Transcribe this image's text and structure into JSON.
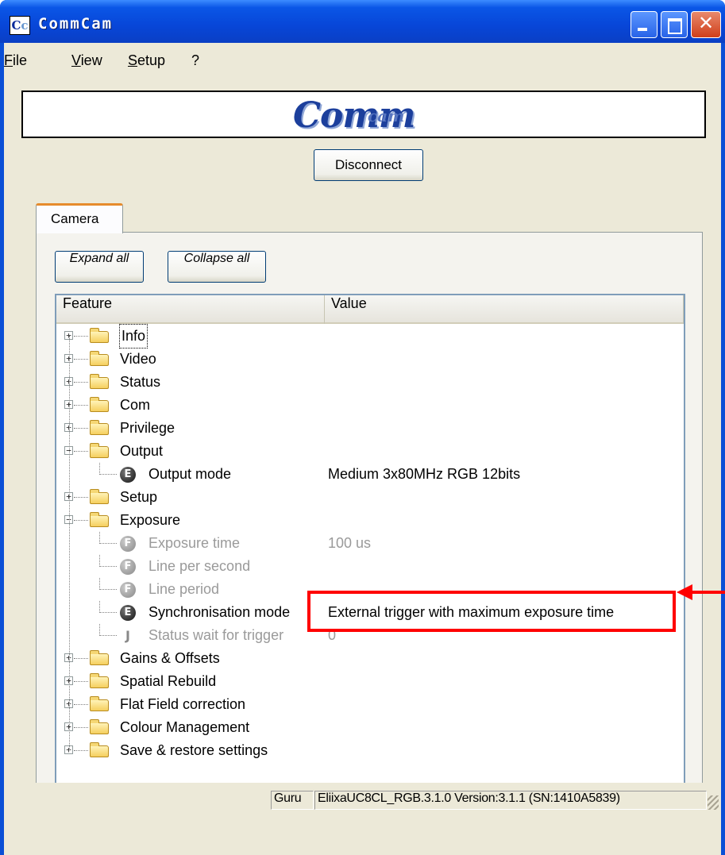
{
  "window": {
    "title": "CommCam",
    "icon": "app-icon",
    "controls": [
      "minimize",
      "maximize",
      "close"
    ]
  },
  "menu": [
    {
      "label": "File",
      "accel": "F"
    },
    {
      "label": "View",
      "accel": "V"
    },
    {
      "label": "Setup",
      "accel": "S"
    },
    {
      "label": "?",
      "accel": ""
    }
  ],
  "logo": {
    "text": "Comm",
    "sub": "cam"
  },
  "buttons": {
    "disconnect": "Disconnect",
    "expand_all": "Expand all",
    "collapse_all": "Collapse all"
  },
  "tabs": [
    {
      "label": "Camera",
      "active": true
    }
  ],
  "tree": {
    "columns": {
      "feature": "Feature",
      "value": "Value"
    },
    "rows": [
      {
        "type": "folder",
        "label": "Info",
        "expanded": false
      },
      {
        "type": "folder",
        "label": "Video",
        "expanded": false
      },
      {
        "type": "folder",
        "label": "Status",
        "expanded": false
      },
      {
        "type": "folder",
        "label": "Com",
        "expanded": false
      },
      {
        "type": "folder",
        "label": "Privilege",
        "expanded": false
      },
      {
        "type": "folder",
        "label": "Output",
        "expanded": true
      },
      {
        "type": "leaf",
        "label": "Output mode",
        "value": "Medium 3x80MHz RGB 12bits",
        "icon": "enum-icon",
        "enabled": true
      },
      {
        "type": "folder",
        "label": "Setup",
        "expanded": false
      },
      {
        "type": "folder",
        "label": "Exposure",
        "expanded": true
      },
      {
        "type": "leaf",
        "label": "Exposure time",
        "value": "100 us",
        "icon": "float-icon",
        "enabled": false
      },
      {
        "type": "leaf",
        "label": "Line per second",
        "value": "",
        "icon": "float-icon",
        "enabled": false
      },
      {
        "type": "leaf",
        "label": "Line period",
        "value": "",
        "icon": "float-icon",
        "enabled": false
      },
      {
        "type": "leaf",
        "label": "Synchronisation mode",
        "value": "External trigger with maximum exposure time",
        "icon": "enum-icon",
        "enabled": true
      },
      {
        "type": "leaf",
        "label": "Status wait for trigger",
        "value": "0",
        "icon": "wait-icon",
        "enabled": false
      },
      {
        "type": "folder",
        "label": "Gains & Offsets",
        "expanded": false
      },
      {
        "type": "folder",
        "label": "Spatial Rebuild",
        "expanded": false
      },
      {
        "type": "folder",
        "label": "Flat Field correction",
        "expanded": false
      },
      {
        "type": "folder",
        "label": "Colour Management",
        "expanded": false
      },
      {
        "type": "folder",
        "label": "Save & restore settings",
        "expanded": false
      }
    ]
  },
  "annotation": {
    "color": "#ff0000"
  },
  "status": {
    "mode": "Guru",
    "info": "EliixaUC8CL_RGB.3.1.0 Version:3.1.1 (SN:1410A5839)"
  },
  "colors": {
    "titlebar": "#0a56e6",
    "window_bg": "#ece9d8",
    "tab_accent": "#e68b2c"
  }
}
